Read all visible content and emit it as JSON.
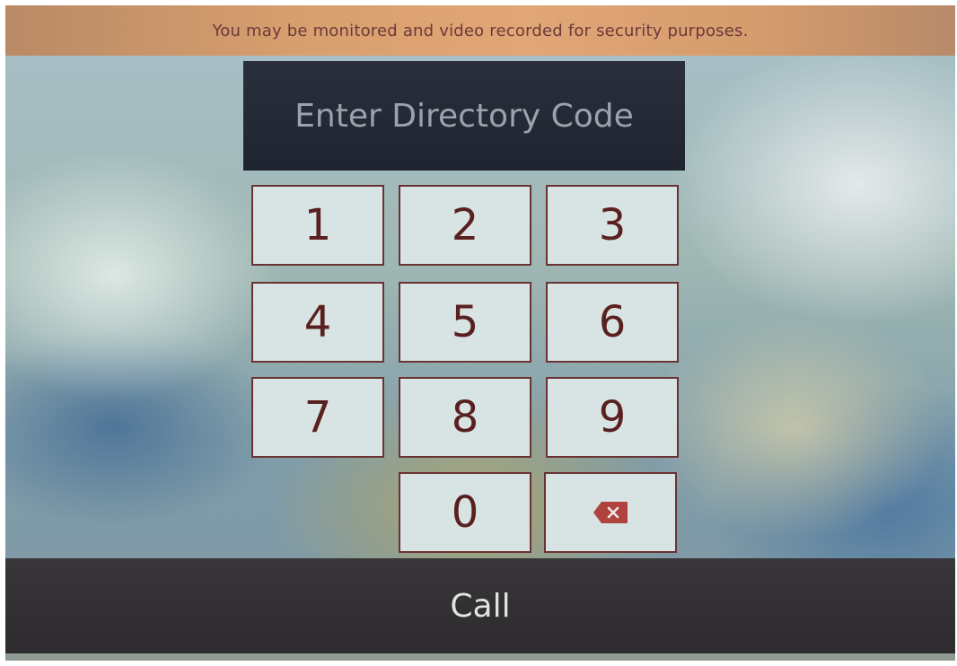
{
  "banner": {
    "text": "You may be monitored and video recorded for security purposes."
  },
  "code_display": {
    "placeholder": "Enter Directory Code"
  },
  "keypad": {
    "keys": [
      "1",
      "2",
      "3",
      "4",
      "5",
      "6",
      "7",
      "8",
      "9",
      "0"
    ],
    "backspace_icon": "backspace-icon"
  },
  "call_button": {
    "label": "Call"
  },
  "colors": {
    "banner": "#d79e6e",
    "banner_text": "#6b3a3a",
    "key_face": "#d8e4e3",
    "key_text": "#5a2020",
    "display_bg": "#1f2430",
    "call_bar": "#2d2b2e",
    "icon_red": "#b0433e"
  }
}
